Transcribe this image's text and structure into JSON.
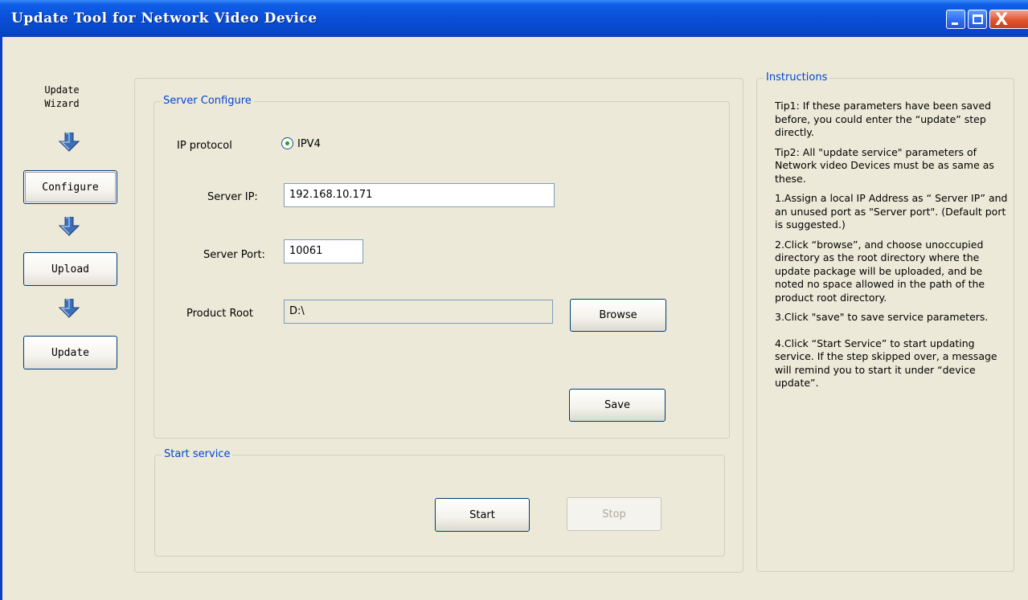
{
  "window": {
    "title": "Update Tool for Network Video Device",
    "controls": [
      "minimize-icon",
      "maximize-icon",
      "close-icon"
    ],
    "close_glyph": "X"
  },
  "wizard": {
    "title": "Update Wizard",
    "steps": [
      {
        "label": "Configure",
        "active": true
      },
      {
        "label": "Upload",
        "active": false
      },
      {
        "label": "Update",
        "active": false
      }
    ],
    "arrow_icon": "arrow-down-icon"
  },
  "server_configure": {
    "legend": "Server Configure",
    "ip_protocol_label": "IP protocol",
    "ip_protocol_option": "IPV4",
    "ip_protocol_selected": true,
    "server_ip_label": "Server IP:",
    "server_ip_value": "192.168.10.171",
    "server_port_label": "Server Port:",
    "server_port_value": "10061",
    "product_root_label": "Product Root",
    "product_root_value": "D:\\",
    "browse_label": "Browse",
    "save_label": "Save"
  },
  "start_service": {
    "legend": "Start service",
    "start_label": "Start",
    "stop_label": "Stop",
    "stop_enabled": false
  },
  "instructions": {
    "legend": "Instructions",
    "tips": [
      "Tip1: If these parameters have been saved before, you could enter the “update” step directly.",
      "Tip2: All \"update service\" parameters of Network video Devices must be as same as these.",
      "1.Assign a local IP Address as “ Server IP” and an unused port as \"Server port\". (Default port is suggested.)",
      "2.Click “browse”, and choose unoccupied directory as the root directory where the update package will be uploaded, and be noted no space allowed in the path of the product root directory.",
      "3.Click \"save\" to save service parameters.",
      "4.Click “Start Service” to start updating service. If the step skipped over, a message will remind you to start it under “device update”."
    ]
  },
  "colors": {
    "titlebar": "#0a4fd6",
    "client_bg": "#ece9d8",
    "legend_text": "#0046d5",
    "arrow_blue": "#3d6fb6",
    "radio_dot": "#21a121",
    "close_button": "#e0552c"
  }
}
